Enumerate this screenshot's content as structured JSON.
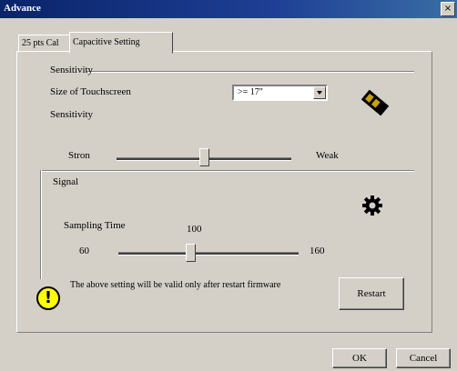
{
  "window": {
    "title": "Advance",
    "close_glyph": "×"
  },
  "tabs": [
    {
      "label": "25 pts Cal"
    },
    {
      "label": "Capacitive Setting",
      "selected": true
    }
  ],
  "sensitivity": {
    "group_title": "Sensitivity",
    "size_label": "Size of Touchscreen",
    "size_value": ">= 17\"",
    "sub_label": "Sensitivity",
    "strong_label": "Stron",
    "weak_label": "Weak",
    "slider_fraction": 0.5,
    "icon": "chip-icon"
  },
  "signal": {
    "group_title": "Signal",
    "sampling_label": "Sampling Time",
    "current_value": "100",
    "min_label": "60",
    "max_label": "160",
    "slider_fraction": 0.4,
    "icon": "gear-icon"
  },
  "notice": "The above setting will be valid only after restart firmware",
  "buttons": {
    "restart": "Restart",
    "ok": "OK",
    "cancel": "Cancel"
  },
  "colors": {
    "titlebar": "#0a246a",
    "face": "#d4d0c8",
    "warning": "#ffff00"
  }
}
